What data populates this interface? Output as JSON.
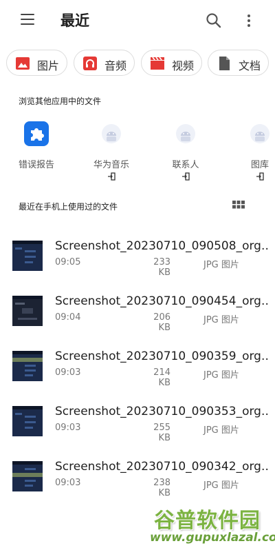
{
  "header": {
    "title": "最近"
  },
  "chips": [
    {
      "label": "图片",
      "icon": "image-icon",
      "color": "#e53935"
    },
    {
      "label": "音频",
      "icon": "headphones-icon",
      "color": "#e53935"
    },
    {
      "label": "视频",
      "icon": "clapperboard-icon",
      "color": "#e53935"
    },
    {
      "label": "文档",
      "icon": "document-icon",
      "color": "#555555"
    }
  ],
  "apps_section": {
    "title": "浏览其他应用中的文件",
    "items": [
      {
        "label": "错误报告",
        "icon": "puzzle-icon",
        "color": "#1a73e8"
      },
      {
        "label": "华为音乐",
        "icon": "android-icon",
        "external": true
      },
      {
        "label": "联系人",
        "icon": "android-icon",
        "external": true
      },
      {
        "label": "图库",
        "icon": "android-icon",
        "external": true
      }
    ]
  },
  "recent_section": {
    "title": "最近在手机上使用过的文件",
    "view_icon": "grid-view-icon"
  },
  "files": [
    {
      "name": "Screenshot_20230710_090508_org.…",
      "time": "09:05",
      "size": "233 KB",
      "type": "JPG 图片"
    },
    {
      "name": "Screenshot_20230710_090454_org.…",
      "time": "09:04",
      "size": "206 KB",
      "type": "JPG 图片"
    },
    {
      "name": "Screenshot_20230710_090359_org.…",
      "time": "09:03",
      "size": "214 KB",
      "type": "JPG 图片"
    },
    {
      "name": "Screenshot_20230710_090353_org.…",
      "time": "09:03",
      "size": "255 KB",
      "type": "JPG 图片"
    },
    {
      "name": "Screenshot_20230710_090342_org.…",
      "time": "09:03",
      "size": "238 KB",
      "type": "JPG 图片"
    }
  ],
  "watermark": {
    "cn": "谷普软件园",
    "en": "www.gupuxlazal.com"
  }
}
